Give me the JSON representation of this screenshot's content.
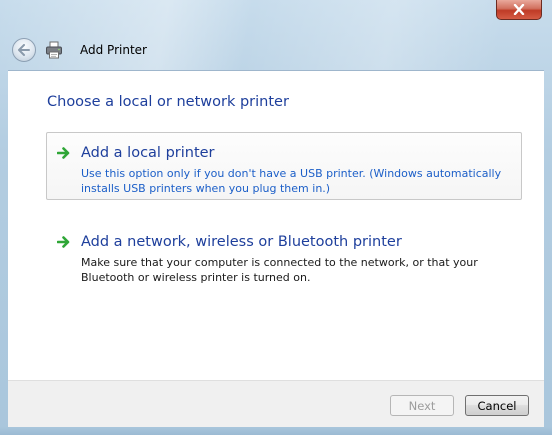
{
  "window": {
    "close_icon": "close-x-icon"
  },
  "nav": {
    "back_icon": "back-arrow-icon",
    "app_icon": "printer-icon",
    "title": "Add Printer"
  },
  "main": {
    "heading": "Choose a local or network printer",
    "options": [
      {
        "icon": "green-arrow-icon",
        "title": "Add a local printer",
        "description": "Use this option only if you don't have a USB printer. (Windows automatically installs USB printers when you plug them in.)"
      },
      {
        "icon": "green-arrow-icon",
        "title": "Add a network, wireless or Bluetooth printer",
        "description": "Make sure that your computer is connected to the network, or that your Bluetooth or wireless printer is turned on."
      }
    ]
  },
  "footer": {
    "next_label": "Next",
    "cancel_label": "Cancel"
  },
  "colors": {
    "heading": "#1e3f9c",
    "link_desc": "#1c5fc8",
    "arrow": "#2fa637",
    "close": "#c9452f"
  }
}
